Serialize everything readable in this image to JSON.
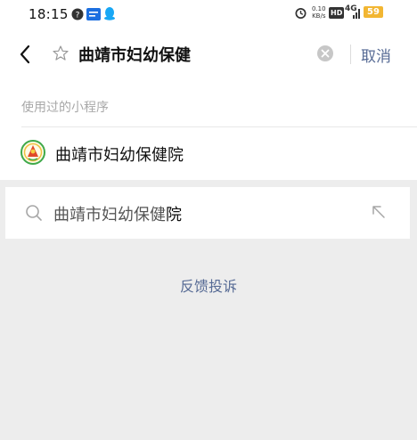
{
  "status_bar": {
    "time": "18:15",
    "net_speed_value": "0.10",
    "net_speed_unit": "KB/s",
    "hd_badge": "HD",
    "network": "4G",
    "battery": "59",
    "battery_color": "#f2b632"
  },
  "search": {
    "query": "曲靖市妇幼保健",
    "cancel_label": "取消"
  },
  "mini_programs": {
    "section_label": "使用过的小程序",
    "items": [
      {
        "name": "曲靖市妇幼保健院"
      }
    ]
  },
  "suggestions": [
    {
      "match": "曲靖市妇幼保健",
      "rest": "院"
    }
  ],
  "feedback_label": "反馈投诉",
  "colors": {
    "link": "#576b95",
    "background": "#ededed"
  }
}
